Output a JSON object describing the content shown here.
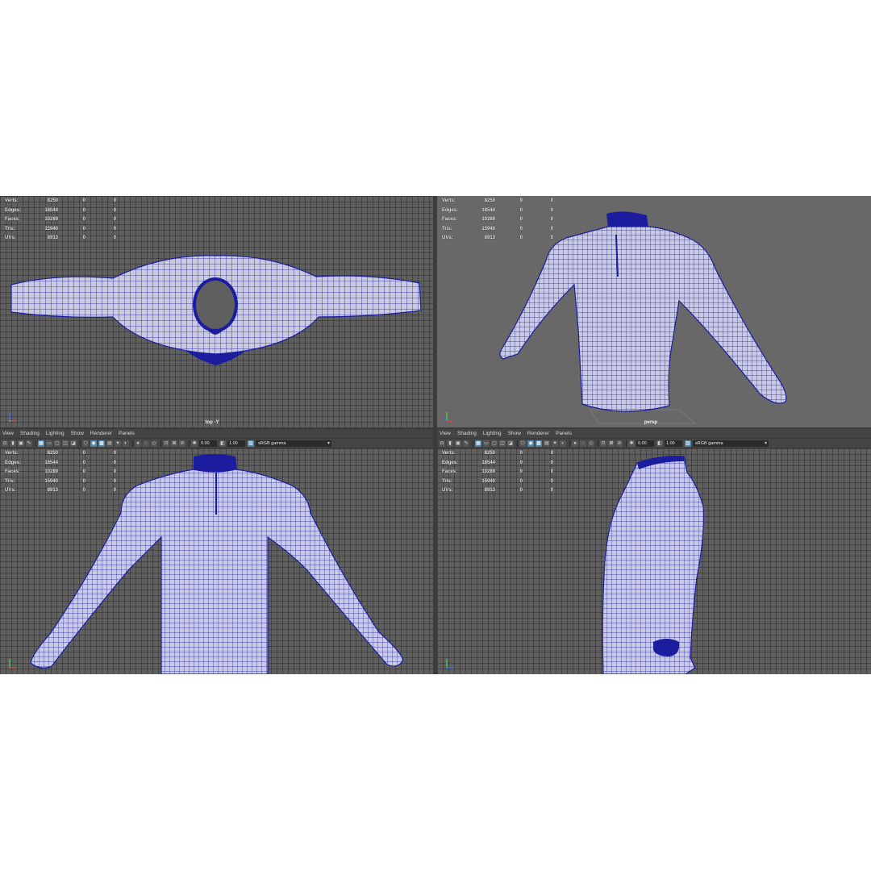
{
  "hud": {
    "labels": {
      "verts": "Verts:",
      "edges": "Edges:",
      "faces": "Faces:",
      "tris": "Tris:",
      "uvs": "UVs:"
    },
    "values": {
      "verts": "8250",
      "edges": "18544",
      "faces": "10289",
      "tris": "15940",
      "uvs": "8913",
      "zero": "0"
    }
  },
  "menu": {
    "view": "View",
    "shading": "Shading",
    "lighting": "Lighting",
    "show": "Show",
    "renderer": "Renderer",
    "panels": "Panels"
  },
  "toolbar": {
    "field1": "0.00",
    "field2": "1.00",
    "colorspace": "sRGB gamma"
  },
  "cameras": {
    "top": "top -Y",
    "persp": "persp"
  },
  "colors": {
    "wire": "#1b1d9e",
    "surface": "#c9cadf",
    "background": "#5f5f5f"
  },
  "icons": [
    "camera-icon",
    "bookmark-icon",
    "image-plane-icon",
    "grid-icon",
    "wireframe-icon",
    "smooth-shade-icon",
    "textured-icon",
    "lights-icon",
    "shadows-icon",
    "xray-icon",
    "isolate-icon",
    "exposure-icon",
    "gamma-icon"
  ]
}
